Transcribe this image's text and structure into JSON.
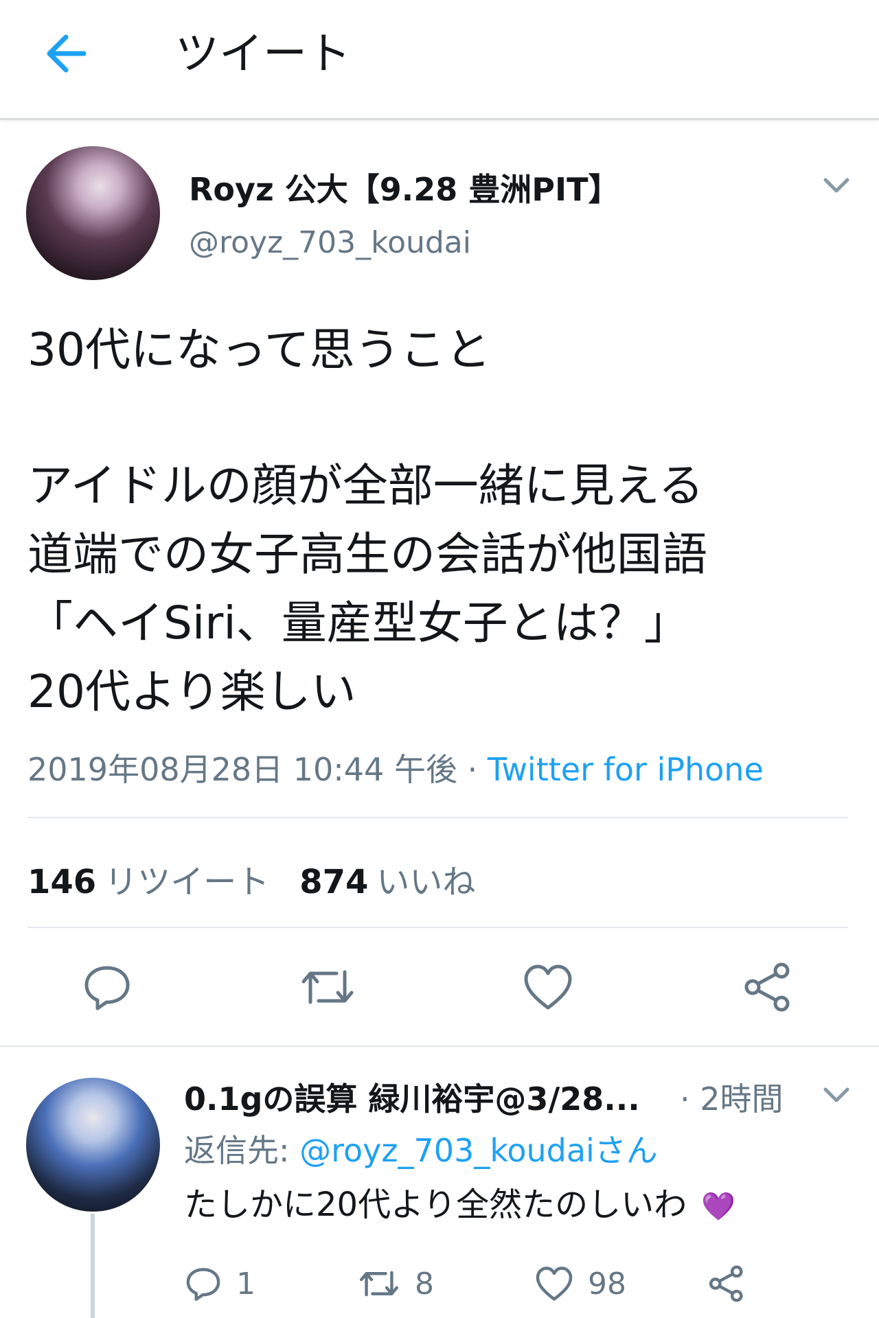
{
  "header": {
    "title": "ツイート",
    "back_icon": "arrow-left-icon",
    "accent": "#1da1f2"
  },
  "tweet": {
    "author_name": "Royz 公大【9.28 豊洲PIT】",
    "author_handle": "@royz_703_koudai",
    "lines": [
      "30代になって思うこと",
      "アイドルの顔が全部一緒に見える",
      "道端での女子高生の会話が他国語",
      "「ヘイSiri、量産型女子とは？」",
      "20代より楽しい"
    ],
    "timestamp": "2019年08月28日 10:44 午後",
    "separator": " · ",
    "source": "Twitter for iPhone",
    "retweet_count": "146",
    "retweet_label": "リツイート",
    "like_count": "874",
    "like_label": "いいね"
  },
  "reply": {
    "author_name": "0.1gの誤算 緑川裕宇@3/28...",
    "time": "· 2時間",
    "reply_to_label": "返信先: ",
    "reply_to_mention": "@royz_703_koudaiさん",
    "text": "たしかに20代より全然たのしいわ",
    "emoji": "💜",
    "reply_count": "1",
    "retweet_count": "8",
    "like_count": "98"
  }
}
